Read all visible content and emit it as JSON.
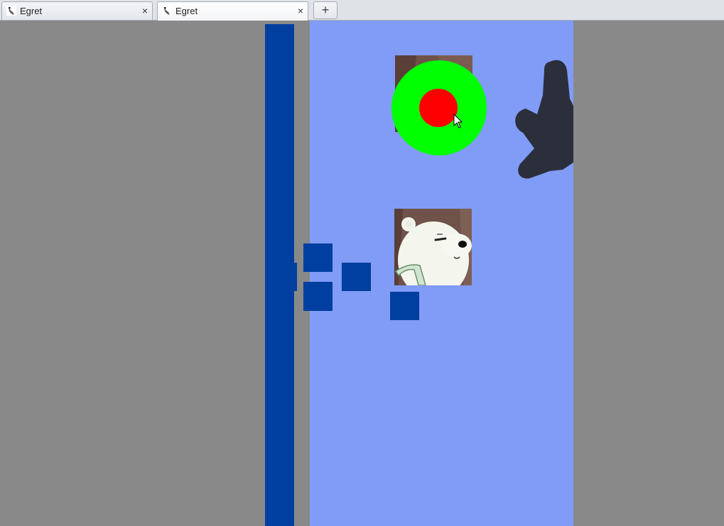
{
  "tabs": [
    {
      "title": "Egret",
      "close": "×"
    },
    {
      "title": "Egret",
      "close": "×"
    }
  ],
  "new_tab_label": "+",
  "icons": {
    "tab": "egret-logo-icon",
    "close": "close-icon",
    "add": "plus-icon",
    "cursor": "mouse-pointer-icon"
  },
  "colors": {
    "page_background": "#898989",
    "stage": "#809cf6",
    "blocks": "#003fa0",
    "joystick_outer": "#00ff00",
    "joystick_inner": "#ff0000",
    "hand_silhouette": "#2b2f3b"
  }
}
